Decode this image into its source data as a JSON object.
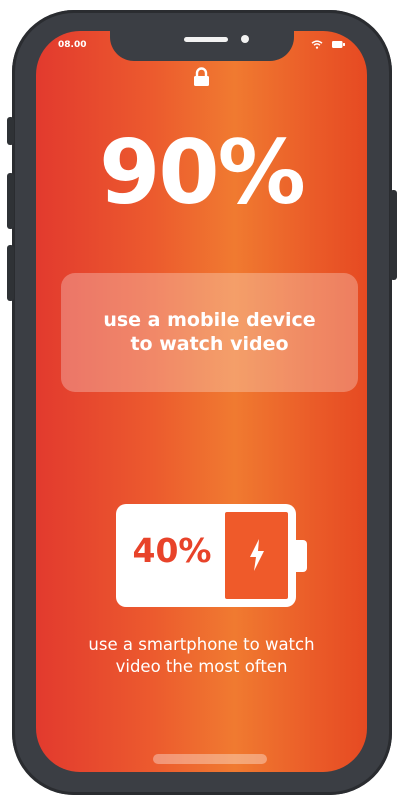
{
  "status_bar": {
    "time": "08.00",
    "icons": [
      "wifi-icon",
      "battery-icon"
    ]
  },
  "lock_icon": "lock-icon",
  "main_stat": {
    "value": "90%",
    "description": "use a mobile device\nto watch video"
  },
  "secondary_stat": {
    "value": "40%",
    "icon": "lightning-bolt-icon",
    "description": "use a smartphone to watch\nvideo the most often"
  },
  "colors": {
    "background_left": "#e23a2e",
    "background_mid": "#f07a30",
    "background_right": "#e64a22",
    "accent": "#e8432a",
    "text": "#ffffff",
    "device_frame": "#3b3e44"
  }
}
